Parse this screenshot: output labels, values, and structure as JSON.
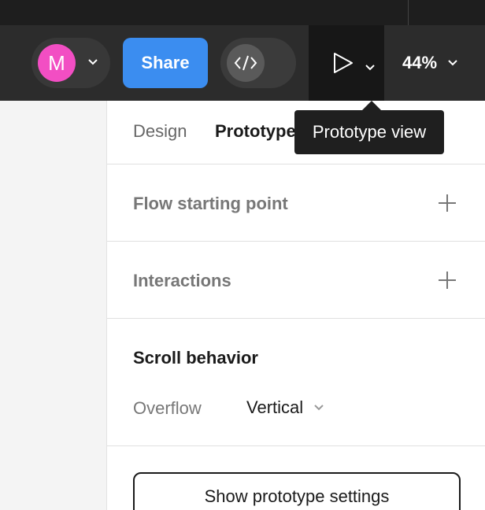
{
  "toolbar": {
    "avatar_initial": "M",
    "share_label": "Share",
    "zoom_label": "44%"
  },
  "tooltip": {
    "text": "Prototype view"
  },
  "panel": {
    "tabs": [
      {
        "label": "Design",
        "active": false
      },
      {
        "label": "Prototype",
        "active": true
      }
    ],
    "flow_starting_point": "Flow starting point",
    "interactions": "Interactions",
    "scroll_behavior": {
      "title": "Scroll behavior",
      "overflow_label": "Overflow",
      "overflow_value": "Vertical"
    },
    "settings_button": "Show prototype settings"
  },
  "icons": {
    "avatar_chevron": "chevron-down-icon",
    "dev_mode": "code-icon",
    "present": "play-icon",
    "present_menu": "chevron-down-icon",
    "zoom_menu": "chevron-down-icon",
    "add_flow": "plus-icon",
    "add_interaction": "plus-icon",
    "overflow_menu": "chevron-down-icon"
  },
  "colors": {
    "accent": "#3b8df0",
    "avatar": "#f24ec3",
    "toolbar": "#2c2c2c",
    "tooltip": "#1f1f1f"
  }
}
